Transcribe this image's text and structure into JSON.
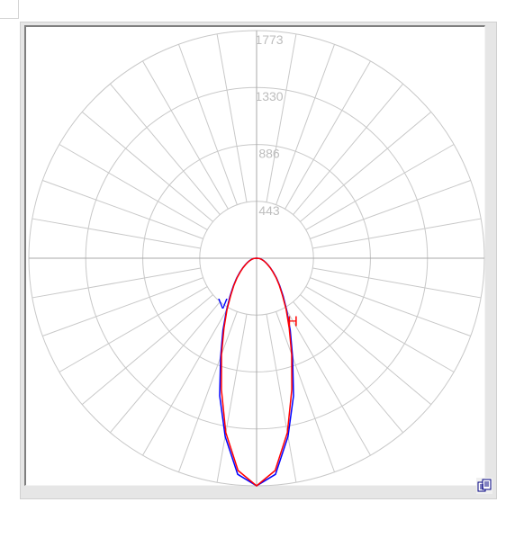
{
  "chart_data": {
    "type": "polar",
    "radial_ticks": [
      "443",
      "886",
      "1330",
      "1773"
    ],
    "radial_tick_values": [
      443,
      886,
      1330,
      1773
    ],
    "radial_max": 1773,
    "angular_gridline_step_deg": 10,
    "grid": true,
    "series": [
      {
        "name": "V",
        "color": "#0000ff",
        "angle_deg": [
          0,
          5,
          10,
          15,
          20,
          25,
          30,
          35,
          40,
          45,
          50,
          55,
          60,
          65,
          70,
          75,
          80,
          85,
          90
        ],
        "values": [
          1773,
          1690,
          1410,
          1110,
          820,
          620,
          470,
          360,
          280,
          220,
          170,
          130,
          100,
          78,
          60,
          45,
          33,
          20,
          0
        ]
      },
      {
        "name": "H",
        "color": "#ff0000",
        "angle_deg": [
          0,
          5,
          10,
          15,
          20,
          25,
          30,
          35,
          40,
          45,
          50,
          55,
          60,
          65,
          70,
          75,
          80,
          85,
          90
        ],
        "values": [
          1773,
          1660,
          1380,
          1060,
          800,
          600,
          460,
          350,
          275,
          215,
          165,
          128,
          98,
          75,
          58,
          43,
          31,
          18,
          0
        ]
      }
    ]
  },
  "toolbar": {
    "copy_icon": "copy-icon"
  }
}
